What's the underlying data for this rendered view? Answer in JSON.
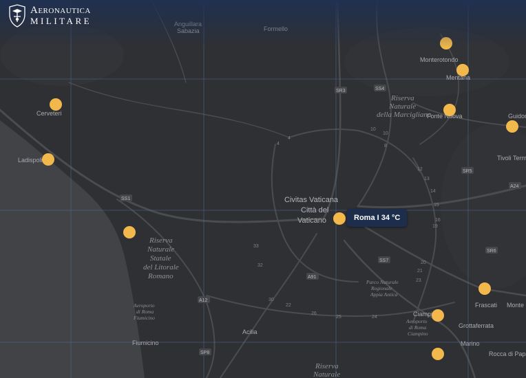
{
  "brand": {
    "line1": "Aeronautica",
    "line2": "MILITARE",
    "logo_icon": "air-force-crest-icon"
  },
  "tooltip": {
    "city": "Roma",
    "temperature": "34 °C",
    "separator": " I ",
    "text": "Roma I 34 °C"
  },
  "map": {
    "places": [
      {
        "name": "Anguillara",
        "id": "anguillara"
      },
      {
        "name": "Sabazia",
        "id": "sabazia"
      },
      {
        "name": "Formello",
        "id": "formello"
      },
      {
        "name": "Monterotondo",
        "id": "monterotondo"
      },
      {
        "name": "Mentana",
        "id": "mentana"
      },
      {
        "name": "Cerveteri",
        "id": "cerveteri"
      },
      {
        "name": "Ladispoli",
        "id": "ladispoli"
      },
      {
        "name": "Fonte Nuova",
        "id": "fonte-nuova"
      },
      {
        "name": "Guidonia",
        "id": "guidonia"
      },
      {
        "name": "Tivoli Terme",
        "id": "tivoli-terme"
      },
      {
        "name": "Civitas Vaticana",
        "id": "civitas-vaticana"
      },
      {
        "name": "Città del",
        "id": "citta-del"
      },
      {
        "name": "Vaticano",
        "id": "vaticano"
      },
      {
        "name": "Frascati",
        "id": "frascati"
      },
      {
        "name": "Monte",
        "id": "monte"
      },
      {
        "name": "Ciampino",
        "id": "ciampino"
      },
      {
        "name": "Grottaferrata",
        "id": "grottaferrata"
      },
      {
        "name": "Marino",
        "id": "marino"
      },
      {
        "name": "Rocca di Papa",
        "id": "rocca-di-papa"
      },
      {
        "name": "Fiumicino",
        "id": "fiumicino"
      },
      {
        "name": "Acilia",
        "id": "acilia"
      }
    ],
    "areas": {
      "marcigliana": [
        "Riserva",
        "Naturale",
        "della Marcigliana"
      ],
      "litorale": [
        "Riserva",
        "Naturale",
        "Statale",
        "del Litorale",
        "Romano"
      ],
      "appia": [
        "Parco Naturale",
        "Regionale",
        "Appia Antica"
      ],
      "airport_fiumicino": [
        "Aeroporto",
        "di Roma",
        "Fiumicino"
      ],
      "airport_ciampino": [
        "Aeroporto",
        "di Roma",
        "Ciampino"
      ],
      "south": [
        "Riserva",
        "Naturale"
      ]
    },
    "road_shields": [
      "SR3",
      "SS4",
      "SR5",
      "A24",
      "SS1",
      "SR6",
      "SS7",
      "A91",
      "A12",
      "SP8"
    ],
    "km_markers": [
      "10",
      "10",
      "8",
      "4",
      "4",
      "12",
      "13",
      "14",
      "15",
      "16",
      "33",
      "32",
      "30",
      "22",
      "20",
      "21",
      "23",
      "24",
      "25",
      "26",
      "19"
    ]
  },
  "station_markers": [
    {
      "id": "monterotondo-north",
      "color": "#f2b84b"
    },
    {
      "id": "mentana",
      "color": "#f2b84b"
    },
    {
      "id": "fonte-nuova",
      "color": "#f2b84b"
    },
    {
      "id": "guidonia",
      "color": "#f2b84b"
    },
    {
      "id": "cerveteri",
      "color": "#f2b84b"
    },
    {
      "id": "ladispoli",
      "color": "#f2b84b"
    },
    {
      "id": "litorale",
      "color": "#f2b84b"
    },
    {
      "id": "roma",
      "color": "#f2b84b"
    },
    {
      "id": "frascati",
      "color": "#f2b84b"
    },
    {
      "id": "ciampino",
      "color": "#f2b84b"
    },
    {
      "id": "marino",
      "color": "#f2b84b"
    }
  ],
  "colors": {
    "land": "#2f3033",
    "sea": "#414347",
    "road": "#4a4c50",
    "grid": "#5876b0",
    "marker": "#f2b84b",
    "tooltip_bg": "#1c2e4c"
  }
}
